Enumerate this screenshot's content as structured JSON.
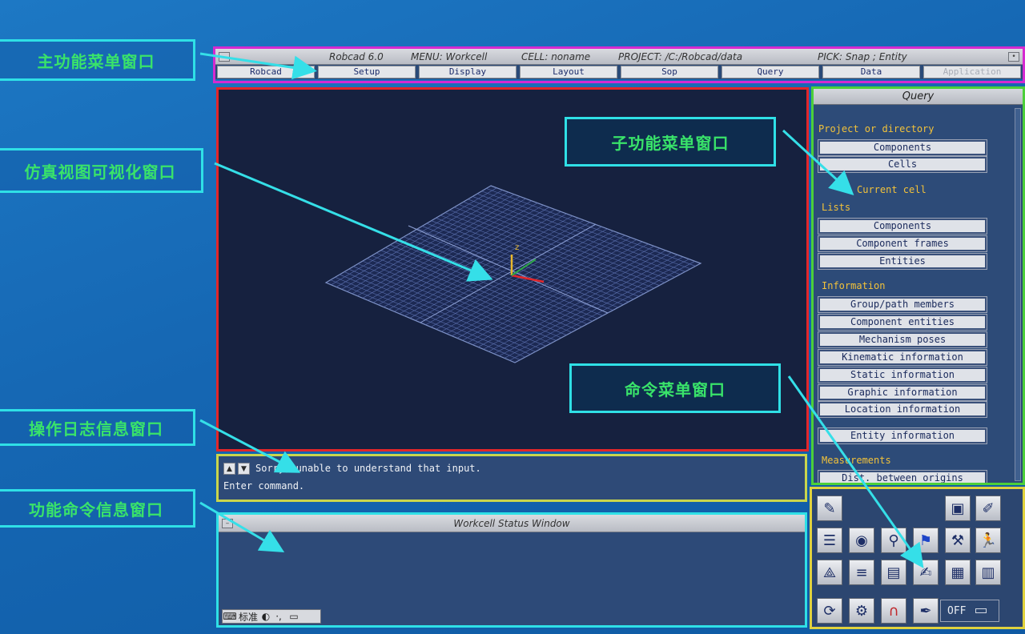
{
  "callouts": {
    "main_menu": "主功能菜单窗口",
    "viewport": "仿真视图可视化窗口",
    "log": "操作日志信息窗口",
    "status": "功能命令信息窗口",
    "submenu": "子功能菜单窗口",
    "command": "命令菜单窗口"
  },
  "titlebar": {
    "app": "Robcad 6.0",
    "menu": "MENU: Workcell",
    "cell": "CELL: noname",
    "project": "PROJECT: /C:/Robcad/data",
    "pick": "PICK: Snap ; Entity"
  },
  "menubar": {
    "items": [
      "Robcad",
      "Setup",
      "Display",
      "Layout",
      "Sop",
      "Query",
      "Data",
      "Application"
    ]
  },
  "query_panel": {
    "title": "Query",
    "project_section": "Project or directory",
    "project_buttons": [
      "Components",
      "Cells"
    ],
    "current_cell": "Current cell",
    "lists_section": "Lists",
    "lists_buttons": [
      "Components",
      "Component frames",
      "Entities"
    ],
    "info_section": "Information",
    "info_buttons": [
      "Group/path members",
      "Component entities",
      "Mechanism poses",
      "Kinematic information",
      "Static information",
      "Graphic information",
      "Location information"
    ],
    "entity_button": "Entity information",
    "measurements_section": "Measurements",
    "measure_button": "Dist. between origins"
  },
  "log": {
    "line1": "Sorry, unable to understand that input.",
    "line2": "Enter command."
  },
  "status_window": {
    "title": "Workcell Status Window",
    "bottom_label": "标准"
  },
  "command_window": {
    "off_label": "OFF"
  },
  "colors": {
    "callout_text": "#39e36a",
    "callout_border": "#2fe0e6",
    "menu_border": "#d52ad0",
    "viewport_border": "#e2262a",
    "query_border": "#4ccf3a",
    "log_border": "#c9d64c",
    "command_border": "#e0d23e"
  }
}
